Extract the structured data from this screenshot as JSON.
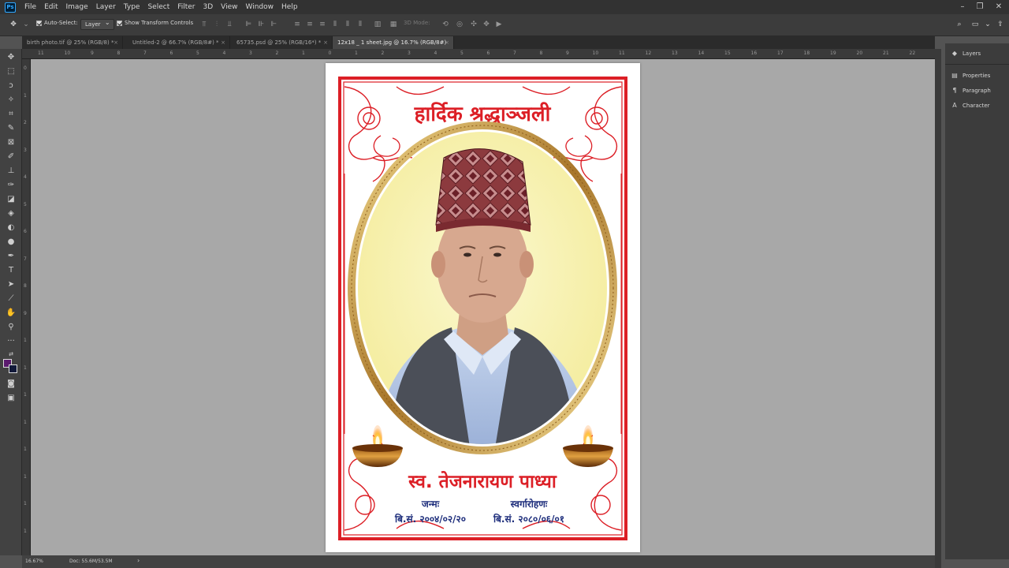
{
  "app": {
    "logo": "Ps"
  },
  "menu": [
    "File",
    "Edit",
    "Image",
    "Layer",
    "Type",
    "Select",
    "Filter",
    "3D",
    "View",
    "Window",
    "Help"
  ],
  "options": {
    "auto_select_label": "Auto-Select:",
    "auto_select_value": "Layer",
    "transform_label": "Show Transform Controls",
    "mode_3d": "3D Mode:"
  },
  "tabs": [
    {
      "label": "birth photo.tif @ 25% (RGB/8) *",
      "close": "×"
    },
    {
      "label": "Untitled-2 @ 66.7% (RGB/8#) *",
      "close": "×"
    },
    {
      "label": "65735.psd @ 25% (RGB/16*) *",
      "close": "×"
    },
    {
      "label": "12x18 _ 1 sheet.jpg @ 16.7% (RGB/8#)",
      "close": "×"
    }
  ],
  "ruler_top": [
    "11",
    "10",
    "9",
    "8",
    "7",
    "6",
    "5",
    "4",
    "3",
    "2",
    "1",
    "0",
    "1",
    "2",
    "3",
    "4",
    "5",
    "6",
    "7",
    "8",
    "9",
    "10",
    "11",
    "12",
    "13",
    "14",
    "15",
    "16",
    "17",
    "18",
    "19",
    "20",
    "21",
    "22"
  ],
  "ruler_left": [
    "0",
    "1",
    "2",
    "3",
    "4",
    "5",
    "6",
    "7",
    "8",
    "9",
    "1",
    "1",
    "1",
    "1",
    "1",
    "1",
    "1",
    "1"
  ],
  "panels": [
    {
      "label": "Layers",
      "icon": "layers-icon"
    },
    {
      "label": "Properties",
      "icon": "properties-icon"
    },
    {
      "label": "Paragraph",
      "icon": "paragraph-icon"
    },
    {
      "label": "Character",
      "icon": "character-icon"
    }
  ],
  "status": {
    "zoom": "16.67%",
    "doc": "Doc: 55.6M/53.5M",
    "arrow": "›"
  },
  "document": {
    "heading": "हार्दिक श्रद्धाञ्जली",
    "name": "स्व. तेजनारायण पाध्या",
    "birth_label": "जन्मः",
    "birth_date": "बि.सं. २००४/०२/२०",
    "death_label": "स्वर्गारोहणः",
    "death_date": "बि.सं. २०८०/०६/०१"
  },
  "colors": {
    "frame_red": "#dc1f26",
    "date_blue": "#1e2e7c",
    "oval_fill": "#f7f2b5",
    "gold": "#c9a24a",
    "foreground": "#5b1a6e",
    "background": "#121a3a"
  }
}
